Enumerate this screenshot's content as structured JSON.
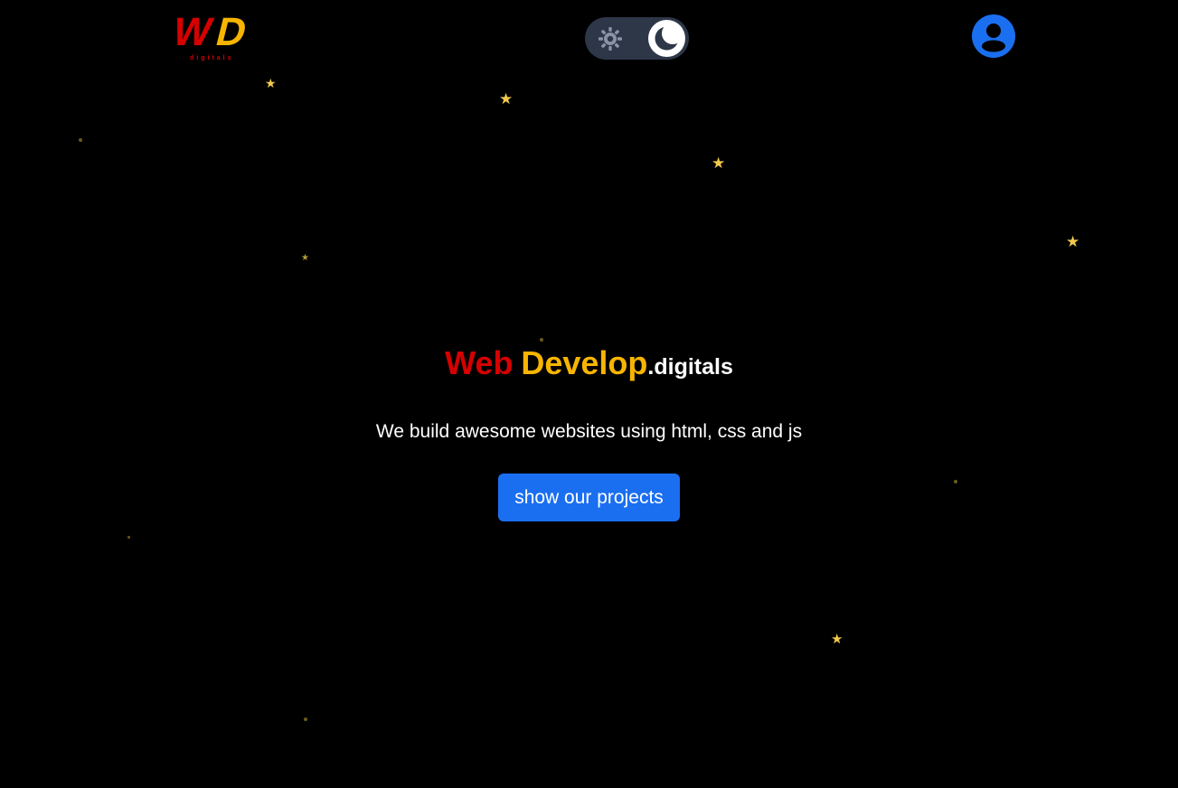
{
  "header": {
    "logo": {
      "mark": "WD",
      "tagline": "digitals",
      "colors": {
        "w": "#d60000",
        "d": "#f7b500"
      }
    },
    "theme_toggle": {
      "state": "dark",
      "off_icon": "sun-icon",
      "on_icon": "moon-icon"
    },
    "user_icon": "user-avatar-icon"
  },
  "hero": {
    "title_part1": "Web",
    "title_part2": "Develop",
    "title_part3": ".digitals",
    "subtitle": "We build awesome websites using html, css and js",
    "cta_label": "show our projects"
  },
  "colors": {
    "background": "#000000",
    "accent_red": "#d60000",
    "accent_yellow": "#f7b500",
    "button_blue": "#1a6ff0",
    "star_gold": "#f2c94c",
    "toggle_track": "#2d3748"
  }
}
